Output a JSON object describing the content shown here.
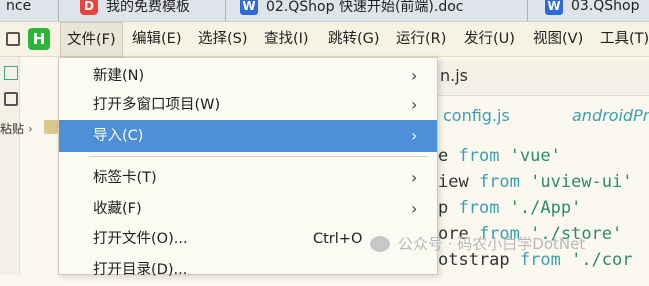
{
  "taskbar": {
    "tabs": [
      {
        "label": "nce"
      },
      {
        "label": "我的免费模板"
      },
      {
        "label": "02.QShop 快速开始(前端).doc"
      },
      {
        "label": "03.QShop"
      }
    ]
  },
  "menubar": {
    "logo_letter": "H",
    "items": [
      {
        "label": "文件(F)"
      },
      {
        "label": "编辑(E)"
      },
      {
        "label": "选择(S)"
      },
      {
        "label": "查找(I)"
      },
      {
        "label": "跳转(G)"
      },
      {
        "label": "运行(R)"
      },
      {
        "label": "发行(U)"
      },
      {
        "label": "视图(V)"
      },
      {
        "label": "工具(T)"
      }
    ]
  },
  "sidebar": {
    "label": "粘贴"
  },
  "editor": {
    "tab_text": "n.js",
    "file_tabs": [
      "config.js",
      "androidPr"
    ],
    "code": [
      {
        "a": "e ",
        "b": "from",
        "c": " 'vue'"
      },
      {
        "a": "iew ",
        "b": "from",
        "c": " 'uview-ui'"
      },
      {
        "a": "p ",
        "b": "from",
        "c": " './App'"
      },
      {
        "a": "ore ",
        "b": "from",
        "c": " './store'"
      },
      {
        "a": "otstrap ",
        "b": "from",
        "c": " './cor"
      }
    ]
  },
  "dropdown": {
    "items": [
      {
        "label": "新建(N)",
        "submenu": true
      },
      {
        "label": "打开多窗口项目(W)",
        "submenu": true
      },
      {
        "label": "导入(C)",
        "submenu": true
      },
      {
        "label": "标签卡(T)",
        "submenu": true
      },
      {
        "label": "收藏(F)",
        "submenu": true
      },
      {
        "label": "打开文件(O)...",
        "shortcut": "Ctrl+O"
      },
      {
        "label": "打开目录(D)..."
      }
    ]
  },
  "watermark": {
    "text": "公众号 · 码农小白学DotNet"
  },
  "colors": {
    "highlight": "#4d8fd8",
    "logo": "#2db43a",
    "editor_bg": "#fbf9ef"
  }
}
